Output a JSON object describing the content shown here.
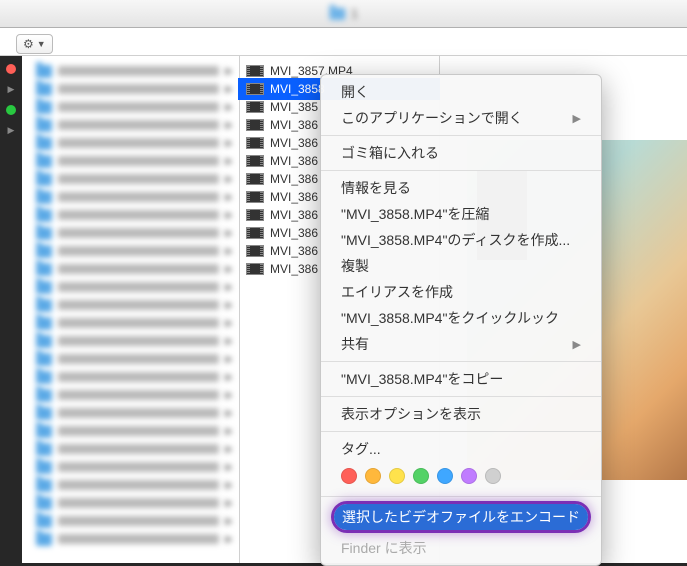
{
  "toolbar": {
    "breadcrumb_text": "1",
    "gear_label": "⚙"
  },
  "sidebar": {
    "item_count": 27
  },
  "files": [
    {
      "name": "MVI_3857.MP4",
      "selected": false
    },
    {
      "name": "MVI_3858",
      "selected": true
    },
    {
      "name": "MVI_385",
      "selected": false
    },
    {
      "name": "MVI_386",
      "selected": false
    },
    {
      "name": "MVI_386",
      "selected": false
    },
    {
      "name": "MVI_386",
      "selected": false
    },
    {
      "name": "MVI_386",
      "selected": false
    },
    {
      "name": "MVI_386",
      "selected": false
    },
    {
      "name": "MVI_386",
      "selected": false
    },
    {
      "name": "MVI_386",
      "selected": false
    },
    {
      "name": "MVI_386",
      "selected": false
    },
    {
      "name": "MVI_386",
      "selected": false
    }
  ],
  "context_menu": {
    "open": "開く",
    "open_with": "このアプリケーションで開く",
    "trash": "ゴミ箱に入れる",
    "get_info": "情報を見る",
    "compress": "\"MVI_3858.MP4\"を圧縮",
    "burn": "\"MVI_3858.MP4\"のディスクを作成...",
    "duplicate": "複製",
    "alias": "エイリアスを作成",
    "quicklook": "\"MVI_3858.MP4\"をクイックルック",
    "share": "共有",
    "copy": "\"MVI_3858.MP4\"をコピー",
    "view_options": "表示オプションを表示",
    "tags": "タグ...",
    "encode": "選択したビデオファイルをエンコード",
    "finder_show": "Finder に表示"
  },
  "tag_colors": [
    "#ff6059",
    "#ffb83c",
    "#ffe24c",
    "#53d266",
    "#3fa7ff",
    "#c07cff",
    "#d0d0d0"
  ]
}
